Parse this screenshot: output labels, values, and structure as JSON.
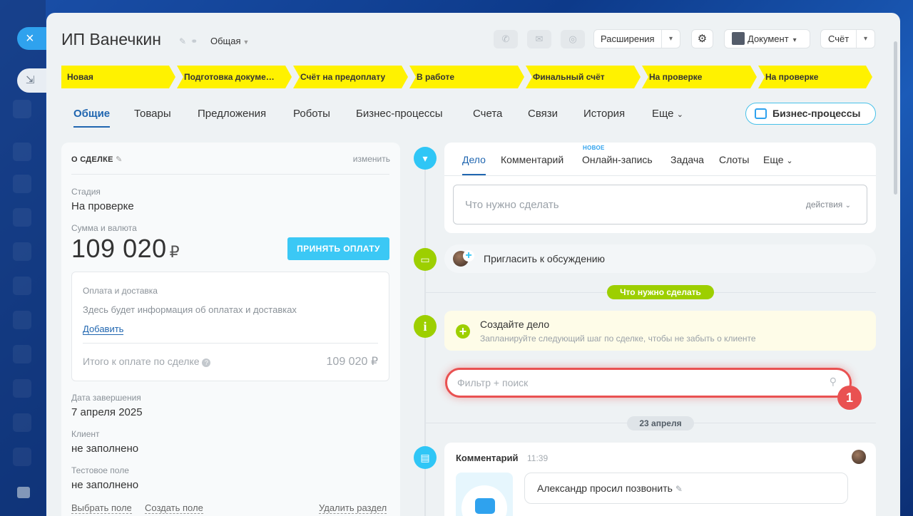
{
  "rail": {
    "close_icon": "×",
    "arrow_icon": "⇲"
  },
  "header": {
    "title": "ИП Ванечкин",
    "category": "Общая",
    "extensions_label": "Расширения",
    "document_label": "Документ",
    "invoice_label": "Счёт"
  },
  "stages": [
    "Новая",
    "Подготовка докуме…",
    "Счёт на предоплату",
    "В работе",
    "Финальный счёт",
    "На проверке",
    "На проверке"
  ],
  "stage_color": "#fff200",
  "tabs": [
    "Общие",
    "Товары",
    "Предложения",
    "Роботы",
    "Бизнес-процессы",
    "Счета",
    "Связи",
    "История",
    "Еще"
  ],
  "bp_button_label": "Бизнес-процессы",
  "deal": {
    "section_title": "О СДЕЛКЕ",
    "edit_label": "изменить",
    "stage_label": "Стадия",
    "stage_value": "На проверке",
    "amount_label": "Сумма и валюта",
    "amount_value": "109 020",
    "currency": "₽",
    "pay_button": "ПРИНЯТЬ ОПЛАТУ",
    "payment_title": "Оплата и доставка",
    "payment_info": "Здесь будет информация об оплатах и доставках",
    "add_link": "Добавить",
    "total_label": "Итого к оплате по сделке",
    "total_value": "109 020 ₽",
    "close_date_label": "Дата завершения",
    "close_date_value": "7 апреля 2025",
    "client_label": "Клиент",
    "client_value": "не заполнено",
    "test_label": "Тестовое поле",
    "test_value": "не заполнено",
    "choose_field": "Выбрать поле",
    "create_field": "Создать поле",
    "delete_section": "Удалить раздел"
  },
  "editor": {
    "tabs": [
      "Дело",
      "Комментарий",
      "Онлайн-запись",
      "Задача",
      "Слоты",
      "Еще"
    ],
    "new_badge": "НОВОЕ",
    "placeholder": "Что нужно сделать",
    "actions_label": "действия"
  },
  "invite_label": "Пригласить к обсуждению",
  "todo_pill": "Что нужно сделать",
  "create_task": {
    "title": "Создайте дело",
    "subtitle": "Запланируйте следующий шаг по сделке, чтобы не забыть о клиенте"
  },
  "filter": {
    "placeholder": "Фильтр + поиск",
    "badge": "1"
  },
  "date_separator": "23 апреля",
  "comment": {
    "type_label": "Комментарий",
    "time": "11:39",
    "text": "Александр просил позвонить"
  },
  "colors": {
    "accent_blue": "#2066b0",
    "timeline_blue": "#2fc6f6",
    "timeline_green": "#9dcf00",
    "highlight_red": "#e95151"
  }
}
